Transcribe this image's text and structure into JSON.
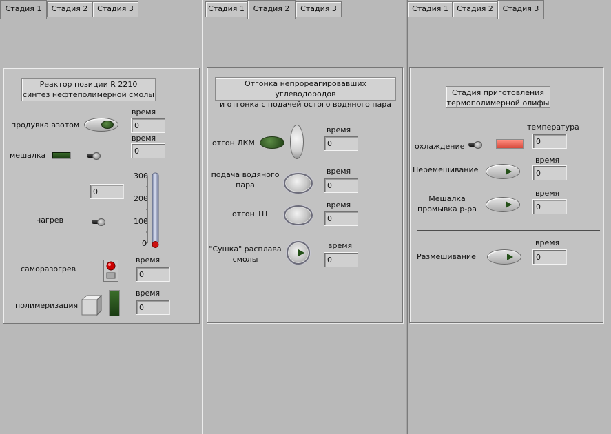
{
  "panes": [
    {
      "tabs": [
        "Стадия 1",
        "Стадия 2",
        "Стадия 3"
      ],
      "active_tab": 0,
      "title_line1": "Реактор позиции R 2210",
      "title_line2": "синтез нефтеполимерной смолы",
      "labels": {
        "purge": "продувка азотом",
        "mixer": "мешалка",
        "heating": "нагрев",
        "selfheat": "саморазогрев",
        "polymer": "полимеризация",
        "time": "время"
      },
      "values": {
        "purge_time": "0",
        "mixer_time": "0",
        "heat_value": "0",
        "selfheat_time": "0",
        "polymer_time": "0"
      },
      "thermo": {
        "ticks": [
          "300",
          "200",
          "100",
          "0"
        ],
        "min": 0,
        "max": 300,
        "value": 0
      },
      "colors": {
        "led_green": "#2b5a1f",
        "thermo_red": "#cc1010",
        "selfheat_red": "#cc0000"
      }
    },
    {
      "tabs": [
        "Стадия 1",
        "Стадия 2",
        "Стадия 3"
      ],
      "active_tab": 1,
      "title_line1": "Отгонка непрореагировавших углеводородов",
      "title_line2": "и отгонка с подачей остого водяного пара",
      "labels": {
        "lkm": "отгон ЛКМ",
        "steam_line1": "подача водяного",
        "steam_line2": "пара",
        "tp": "отгон ТП",
        "dry_line1": "\"Сушка\" расплава",
        "dry_line2": "смолы",
        "time": "время"
      },
      "values": {
        "lkm_time": "0",
        "steam_time": "0",
        "tp_time": "0",
        "dry_time": "0"
      }
    },
    {
      "tabs": [
        "Стадия 1",
        "Стадия 2",
        "Стадия 3"
      ],
      "active_tab": 2,
      "title_line1": "Стадия приготовления",
      "title_line2": "термополимерной олифы",
      "labels": {
        "cooling": "охлаждение",
        "temperature": "температура",
        "mixing": "Перемешивание",
        "wash_line1": "Мешалка",
        "wash_line2": "промывка р-ра",
        "stir": "Размешивание",
        "time": "время"
      },
      "values": {
        "temperature": "0",
        "mixing_time": "0",
        "wash_time": "0",
        "stir_time": "0"
      },
      "colors": {
        "cooling_led": "#f06a5c"
      }
    }
  ]
}
